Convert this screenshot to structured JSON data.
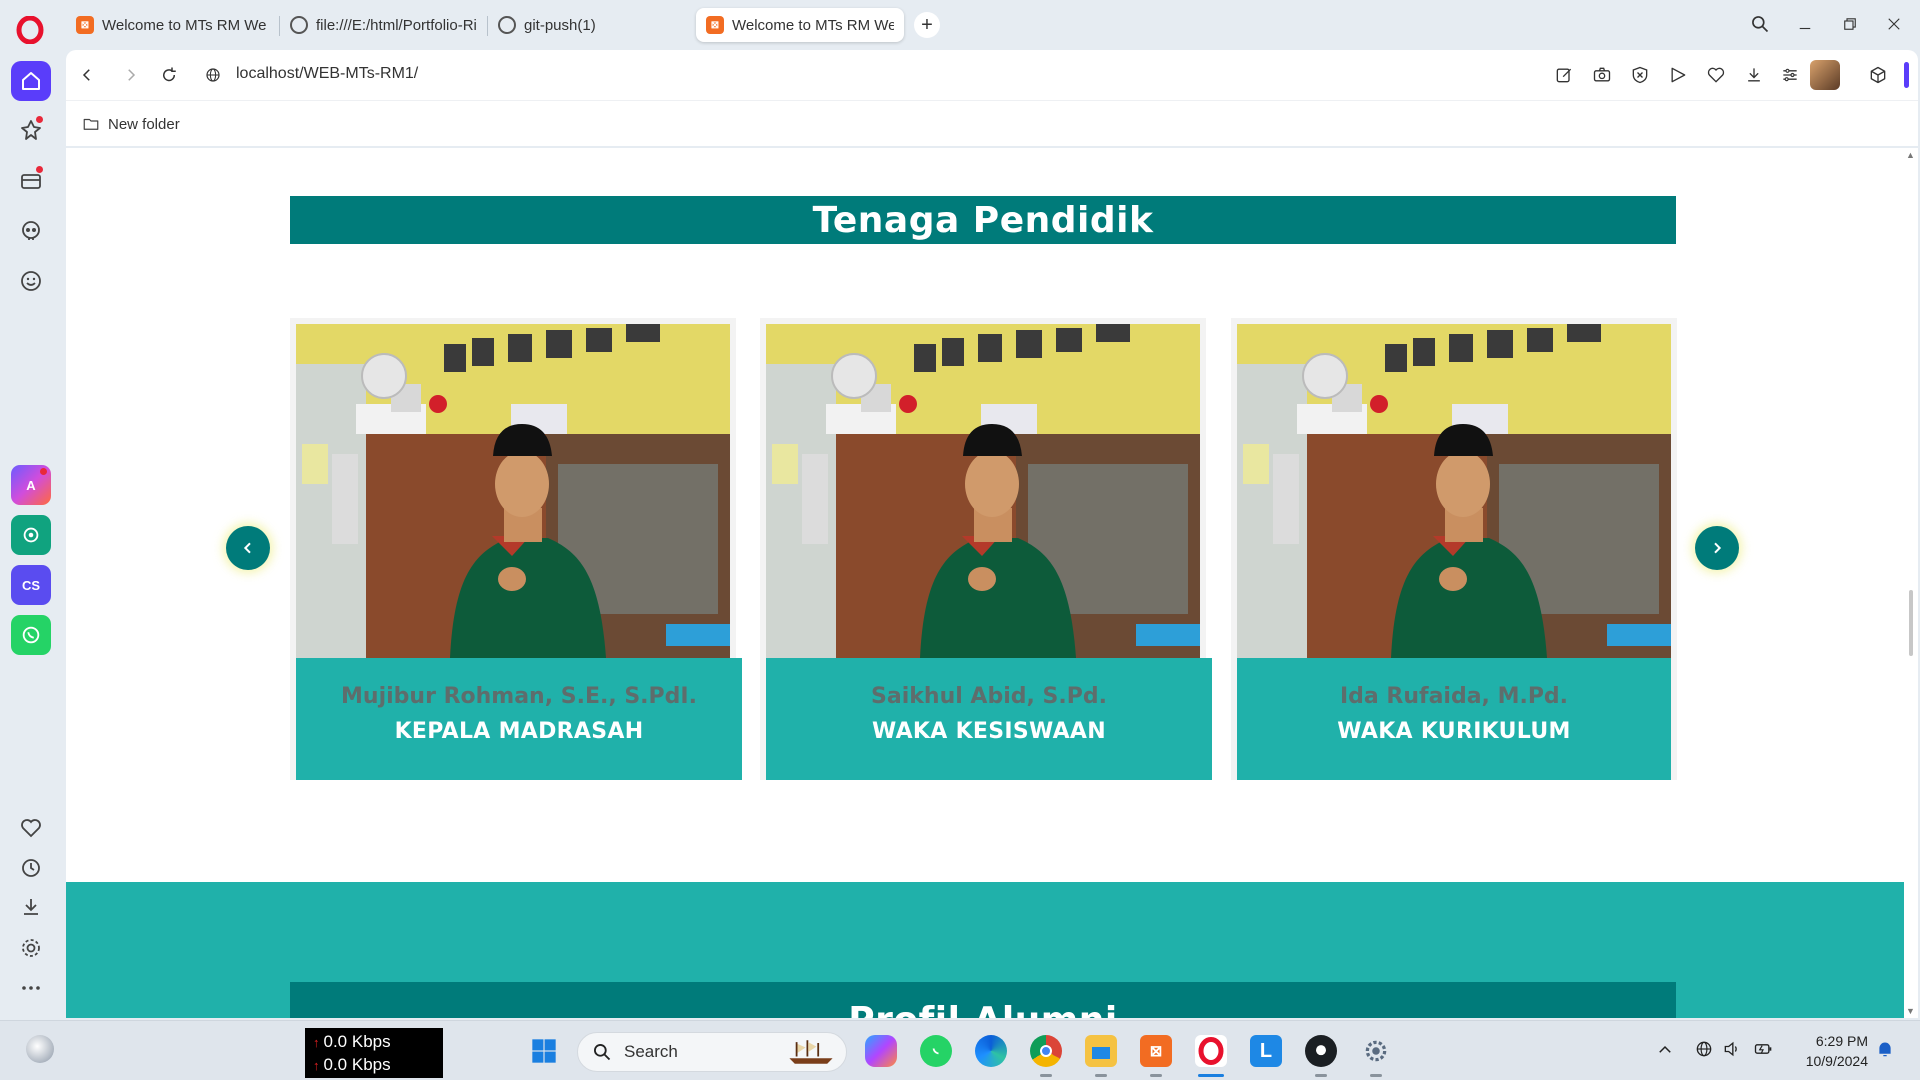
{
  "browser": {
    "tabs": [
      {
        "title": "Welcome to MTs RM Web",
        "favicon": "xampp-icon",
        "active": false
      },
      {
        "title": "file:///E:/html/Portfolio-Ri",
        "favicon": "globe-icon",
        "active": false
      },
      {
        "title": "git-push(1)",
        "favicon": "globe-icon",
        "active": false
      },
      {
        "title": "Welcome to MTs RM Web",
        "favicon": "xampp-icon",
        "active": true
      }
    ],
    "new_tab_label": "+",
    "url": "localhost/WEB-MTs-RM1/",
    "bookmarks": [
      {
        "label": "New folder"
      }
    ]
  },
  "page": {
    "section_title": "Tenaga Pendidik",
    "teachers": [
      {
        "name": "Mujibur Rohman, S.E., S.PdI.",
        "role": "KEPALA MADRASAH"
      },
      {
        "name": "Saikhul Abid, S.Pd.",
        "role": "WAKA KESISWAAN"
      },
      {
        "name": "Ida Rufaida, M.Pd.",
        "role": "WAKA KURIKULUM"
      }
    ],
    "next_section_title": "Profil Alumni",
    "colors": {
      "primary": "#007b7a",
      "card_info": "#20b1aa",
      "name_text": "#5e6d6c"
    }
  },
  "taskbar": {
    "net_up": "0.0 Kbps",
    "net_down": "0.0 Kbps",
    "search_placeholder": "Search",
    "time": "6:29 PM",
    "date": "10/9/2024"
  }
}
